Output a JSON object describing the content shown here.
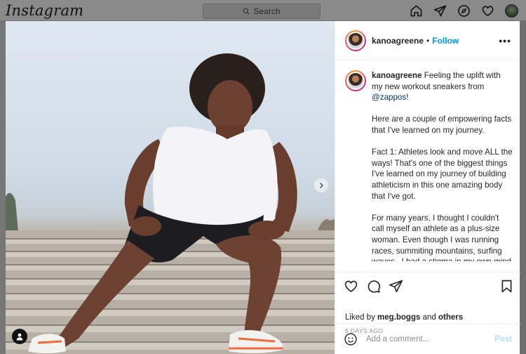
{
  "topbar": {
    "logo": "Instagram",
    "search_placeholder": "Search",
    "icons": [
      "home-icon",
      "direct-icon",
      "explore-icon",
      "activity-heart-icon",
      "profile-avatar"
    ]
  },
  "post": {
    "username": "kanoagreene",
    "separator": "•",
    "follow_label": "Follow",
    "more_label": "•••",
    "caption": {
      "username": "kanoagreene",
      "line1_text": "Feeling the uplift with my new workout sneakers from",
      "mention": "@zappos",
      "line1_end": "!",
      "para2": "Here are a couple of empowering facts that I've learned on my journey.",
      "para3": "Fact 1: Athletes look and move ALL the ways! That's one of the biggest things I've learned on my journey of building athleticism in this one amazing body that I've got.",
      "para4": "For many years, I thought I couldn't call myself an athlete as a plus-size woman. Even though I was running races, summiting mountains, surfing waves...I had a stigma in my own mind that athletes could only look or move a certain way...and I was so wrong!"
    },
    "liked_prefix": "Liked by",
    "liked_user": "meg.boggs",
    "liked_middle": "and",
    "liked_others": "others",
    "time_ago": "6 DAYS AGO",
    "comment_placeholder": "Add a comment...",
    "post_label": "Post"
  },
  "colors": {
    "follow": "#0095f6",
    "post_disabled": "#b2dffc",
    "muted": "#8e8e8e"
  }
}
